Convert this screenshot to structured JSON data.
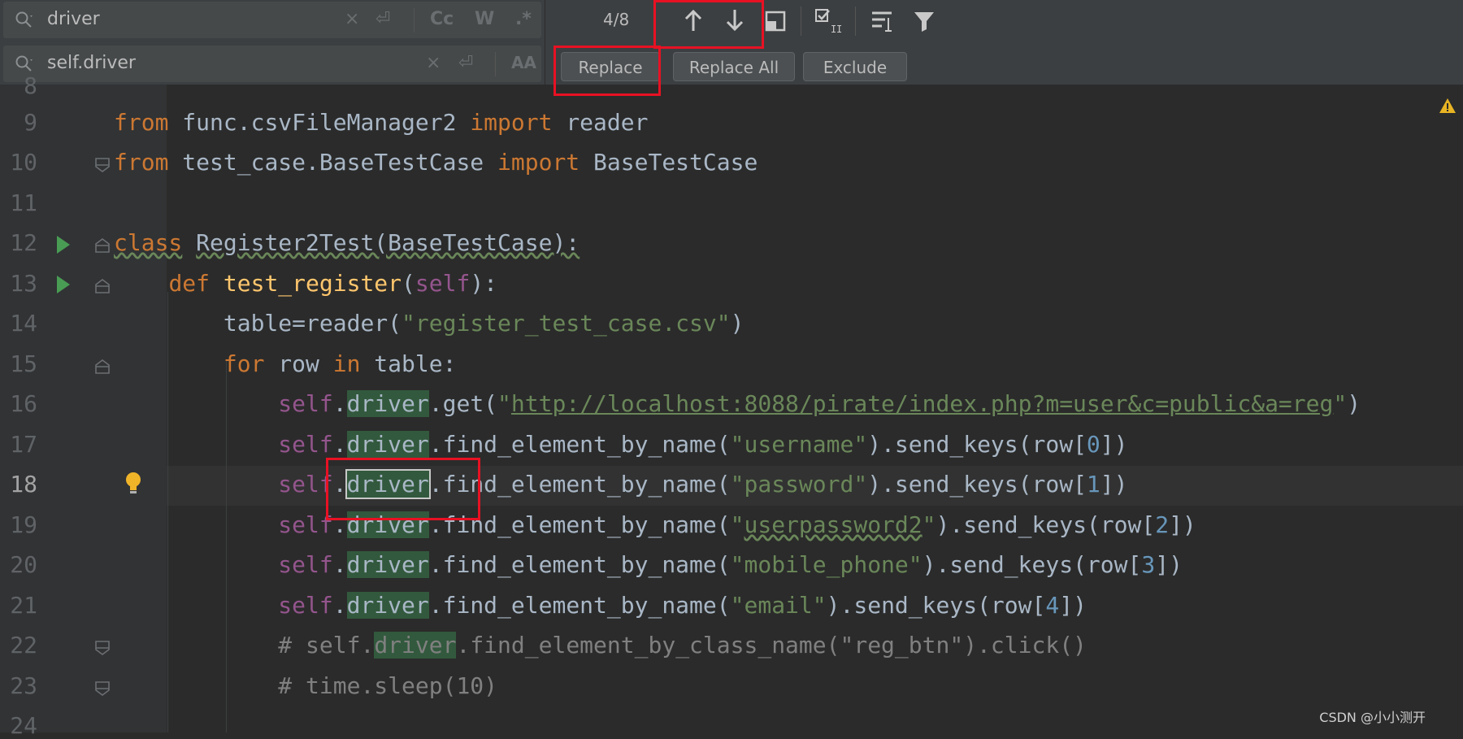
{
  "search": {
    "find_value": "driver",
    "replace_value": "self.driver",
    "match_count": "4/8",
    "find_options": [
      "Cc",
      "W",
      ".*"
    ],
    "replace_options": [
      "AA"
    ],
    "buttons": {
      "replace": "Replace",
      "replace_all": "Replace All",
      "exclude": "Exclude"
    },
    "toolbar_icons": [
      "arrow-up-icon",
      "arrow-down-icon",
      "pin-window-icon",
      "multiline-select-icon",
      "filter-lines-icon",
      "filter-icon"
    ]
  },
  "editor": {
    "current_line": "18",
    "lines": [
      {
        "num": "8"
      },
      {
        "num": "9"
      },
      {
        "num": "10"
      },
      {
        "num": "11"
      },
      {
        "num": "12"
      },
      {
        "num": "13"
      },
      {
        "num": "14"
      },
      {
        "num": "15"
      },
      {
        "num": "16"
      },
      {
        "num": "17"
      },
      {
        "num": "18"
      },
      {
        "num": "19"
      },
      {
        "num": "20"
      },
      {
        "num": "21"
      },
      {
        "num": "22"
      },
      {
        "num": "23"
      },
      {
        "num": "24"
      }
    ],
    "code": {
      "l9": {
        "kw1": "from",
        "mod": " func.csvFileManager2 ",
        "kw2": "import",
        "name": " reader"
      },
      "l10": {
        "kw1": "from",
        "mod": " test_case.BaseTestCase ",
        "kw2": "import",
        "name": " BaseTestCase"
      },
      "l12": {
        "kw": "class",
        "sp": " ",
        "name": "Register2Test(BaseTestCase):"
      },
      "l13": {
        "kw": "def",
        "fn": "test_register",
        "open": "(",
        "self": "self",
        "close": "):"
      },
      "l14": {
        "pre": "table",
        "eq": "=",
        "mid": "reader(",
        "str": "\"register_test_case.csv\"",
        "post": ")"
      },
      "l15": {
        "kw1": "for",
        "mid1": " row ",
        "kw2": "in",
        "mid2": " table:"
      },
      "l16": {
        "self": "self",
        "dot": ".",
        "drv": "driver",
        "call": ".get(",
        "q1": "\"",
        "url": "http://localhost:8088/pirate/index.php?m=user&c=public&a=reg",
        "q2": "\"",
        "end": ")"
      },
      "l17": {
        "self": "self",
        "dot": ".",
        "drv": "driver",
        "call": ".find_element_by_name(",
        "str": "\"username\"",
        "mid": ").send_keys(row[",
        "num": "0",
        "end": "])"
      },
      "l18": {
        "self": "self",
        "dot": ".",
        "drv": "driver",
        "call": ".find_element_by_name(",
        "str": "\"password\"",
        "mid": ").send_keys(row[",
        "num": "1",
        "end": "])"
      },
      "l19": {
        "self": "self",
        "dot": ".",
        "drv": "driver",
        "call": ".find_element_by_name(",
        "q1": "\"",
        "str": "userpassword2",
        "q2": "\"",
        "mid": ").send_keys(row[",
        "num": "2",
        "end": "])"
      },
      "l20": {
        "self": "self",
        "dot": ".",
        "drv": "driver",
        "call": ".find_element_by_name(",
        "str": "\"mobile_phone\"",
        "mid": ").send_keys(row[",
        "num": "3",
        "end": "])"
      },
      "l21": {
        "self": "self",
        "dot": ".",
        "drv": "driver",
        "call": ".find_element_by_name(",
        "str": "\"email\"",
        "mid": ").send_keys(row[",
        "num": "4",
        "end": "])"
      },
      "l22": {
        "pre": "# self.",
        "drv": "driver",
        "post": ".find_element_by_class_name(\"reg_btn\").click()"
      },
      "l23": {
        "text": "# time.sleep(10)"
      }
    }
  },
  "watermark": "CSDN @小小测开",
  "colors": {
    "keyword": "#cc7832",
    "function": "#ffc66d",
    "self": "#94558d",
    "string": "#6a8759",
    "number": "#6897bb",
    "comment": "#808080",
    "match_highlight": "#32593d",
    "annotation_red": "#e81123"
  }
}
